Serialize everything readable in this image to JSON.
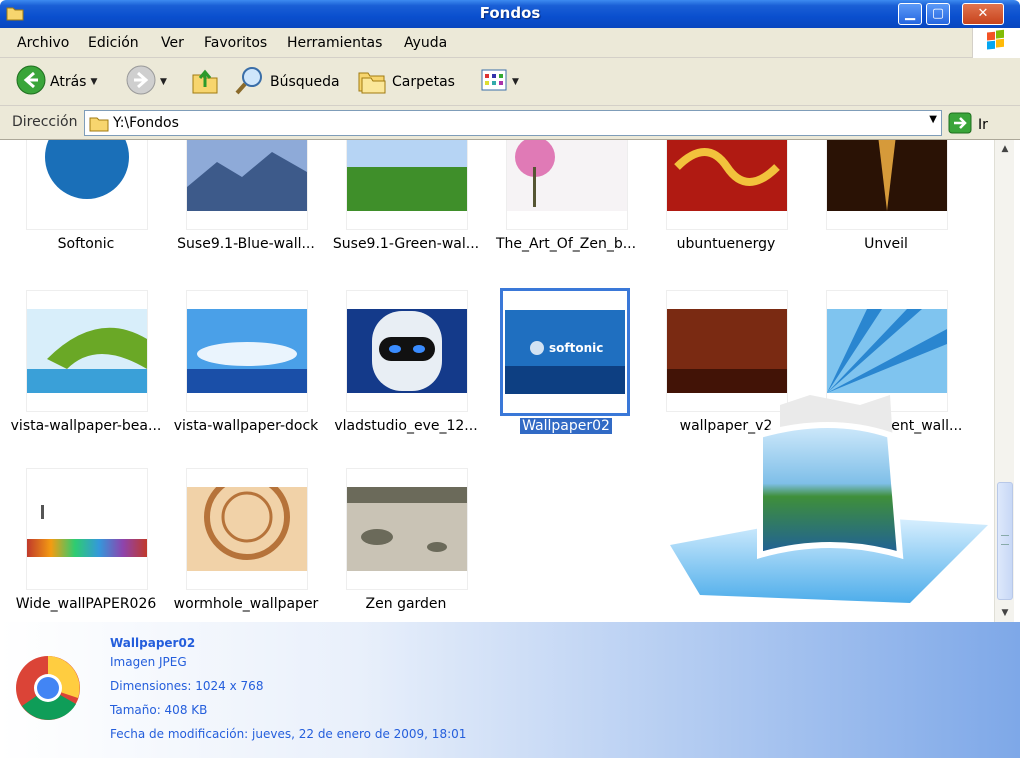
{
  "window": {
    "title": "Fondos"
  },
  "menu": [
    "Archivo",
    "Edición",
    "Ver",
    "Favoritos",
    "Herramientas",
    "Ayuda"
  ],
  "toolbar": {
    "back_label": "Atrás",
    "search_label": "Búsqueda",
    "folders_label": "Carpetas"
  },
  "address": {
    "label": "Dirección",
    "value": "Y:\\Fondos",
    "go_label": "Ir"
  },
  "rows": [
    [
      {
        "name": "Softonic",
        "colors": [
          "#ffffff",
          "#1a6fb8"
        ]
      },
      {
        "name": "Suse9.1-Blue-wall...",
        "colors": [
          "#8eaad8",
          "#3d5a8a"
        ]
      },
      {
        "name": "Suse9.1-Green-wal...",
        "colors": [
          "#b6d4f4",
          "#3f8f2a"
        ]
      },
      {
        "name": "The_Art_Of_Zen_b...",
        "colors": [
          "#f6f3f5",
          "#e07ab6"
        ]
      },
      {
        "name": "ubuntuenergy",
        "colors": [
          "#f2c23c",
          "#b01a12"
        ]
      },
      {
        "name": "Unveil",
        "colors": [
          "#d69a3a",
          "#2a1205"
        ]
      }
    ],
    [
      {
        "name": "vista-wallpaper-bea...",
        "colors": [
          "#d8eefa",
          "#3aa0d8"
        ]
      },
      {
        "name": "vista-wallpaper-dock",
        "colors": [
          "#4aa0e8",
          "#1a4fa8"
        ]
      },
      {
        "name": "vladstudio_eve_12...",
        "colors": [
          "#143a8a",
          "#e8eef4"
        ]
      },
      {
        "name": "Wallpaper02",
        "colors": [
          "#1f6fc0",
          "#0d3f82"
        ],
        "selected": true
      },
      {
        "name": "wallpaper_v2",
        "colors": [
          "#7a2a12",
          "#421306"
        ]
      },
      {
        "name": "water_element_wall...",
        "colors": [
          "#7fc4ef",
          "#2a86d0"
        ]
      }
    ],
    [
      {
        "name": "Wide_wallPAPER026",
        "colors": [
          "#ffffff",
          "#e0e0e0"
        ]
      },
      {
        "name": "wormhole_wallpaper",
        "colors": [
          "#f1d2a8",
          "#b6733a"
        ]
      },
      {
        "name": "Zen garden",
        "colors": [
          "#c9c3b5",
          "#6b6a5a"
        ]
      }
    ]
  ],
  "details": {
    "name": "Wallpaper02",
    "type": "Imagen JPEG",
    "dimensions": "Dimensiones: 1024 x 768",
    "size": "Tamaño: 408 KB",
    "modified": "Fecha de modificación: jueves, 22 de enero de 2009, 18:01"
  },
  "colors": {
    "titlebar": "#0a4fce",
    "selection": "#316ac5",
    "chrome": "#ece9d8"
  }
}
